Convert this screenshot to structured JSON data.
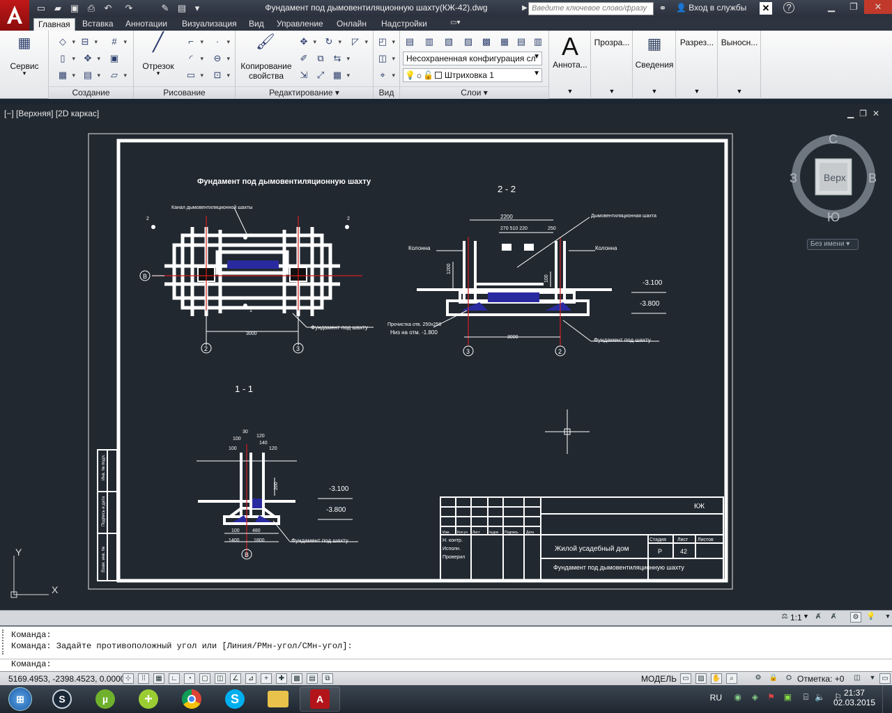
{
  "titlebar": {
    "doc_title": "Фундамент под дымовентиляционную шахту(КЖ-42).dwg",
    "search_placeholder": "Введите ключевое слово/фразу",
    "signin": "Вход в службы"
  },
  "ribbon_tabs": [
    "Главная",
    "Вставка",
    "Аннотации",
    "Визуализация",
    "Вид",
    "Управление",
    "Онлайн",
    "Надстройки"
  ],
  "ribbon": {
    "service_label": "Сервис",
    "panel_create": "Создание",
    "segment_label": "Отрезок",
    "panel_draw": "Рисование",
    "copy_props_label": "Копирование свойства",
    "panel_edit": "Редактирование",
    "panel_view": "Вид",
    "layer_state": "Несохраненная конфигурация сл",
    "current_layer": "Штриховка 1",
    "panel_layers": "Слои",
    "annotate_label": "Аннота...",
    "transparency_label": "Прозра...",
    "info_label": "Сведения",
    "sections_label": "Разрез...",
    "leaders_label": "Выносн..."
  },
  "viewport": {
    "label": "[−] [Верхняя] [2D каркас]",
    "viewcube": {
      "top": "Верх",
      "n": "С",
      "s": "Ю",
      "w": "З",
      "e": "В"
    },
    "unnamed": "Без имени"
  },
  "drawing": {
    "plan_title": "Фундамент под  дымовентиляционную шахту",
    "plan_note_top": "Канал дымовентиляционной шахты",
    "plan_foundation": "Фундамент под шахту",
    "plan_dim_3000": "3000",
    "plan_axis_b": "В",
    "plan_axis_2": "2",
    "plan_axis_3": "3",
    "plan_cut_2": "2",
    "plan_cut_1": "1",
    "section22_title": "2 - 2",
    "s22_shaft": "Дымовентиляционная шахта",
    "s22_column": "Колонна",
    "s22_dim_2200": "2200",
    "s22_dims_small": "270  510  220",
    "s22_dim_250": "250",
    "s22_dim_1200": "1200",
    "s22_dim_100": "100",
    "s22_note1": "Прочистка отв. 250х250",
    "s22_note2": "Низ на отм. -1.800",
    "s22_level1": "-3.100",
    "s22_level2": "-3.800",
    "s22_dim_3000": "3000",
    "s22_foundation": "Фундамент под шахту",
    "section11_title": "1 - 1",
    "s11_dims_top": [
      "30",
      "100",
      "120",
      "140",
      "100",
      "120"
    ],
    "s11_dim_200": "200",
    "s11_dim_100": "100",
    "s11_dim_480": "480",
    "s11_dim_1400": "1400",
    "s11_dim_1800": "1800",
    "s11_level1": "-3.100",
    "s11_level2": "-3.800",
    "s11_foundation": "Фундамент под шахту",
    "stamp_code": "КЖ",
    "stamp_object": "Жилой усадебный дом",
    "stamp_sheet_title": "Фундамент под дымовентиляционную шахту",
    "stamp_stage_h": "Стадия",
    "stamp_sheet_h": "Лист",
    "stamp_sheets_h": "Листов",
    "stamp_stage": "Р",
    "stamp_sheet": "42",
    "stamp_roles": [
      "Н. контр.",
      "Исполн.",
      "Проверил"
    ],
    "stamp_cols": [
      "Изм.",
      "Кол.уч",
      "Лист",
      "№док",
      "Подпись",
      "Дата"
    ],
    "side_strip": [
      "Инв. № подл.",
      "Подпись и дата",
      "Взам. инв. №"
    ],
    "ucs_x": "X",
    "ucs_y": "Y"
  },
  "anno_strip": {
    "scale": "1:1"
  },
  "command": {
    "line1": "Команда:",
    "line2": "Команда: Задайте противоположный угол или [Линия/РМн-угол/СМн-угол]:",
    "prompt": "Команда:"
  },
  "statusbar": {
    "coords": "5169.4953, -2398.4523, 0.0000",
    "model": "МОДЕЛЬ",
    "snap_label": "Отметка: +0"
  },
  "taskbar": {
    "lang": "RU",
    "time": "21:37",
    "date": "02.03.2015"
  }
}
